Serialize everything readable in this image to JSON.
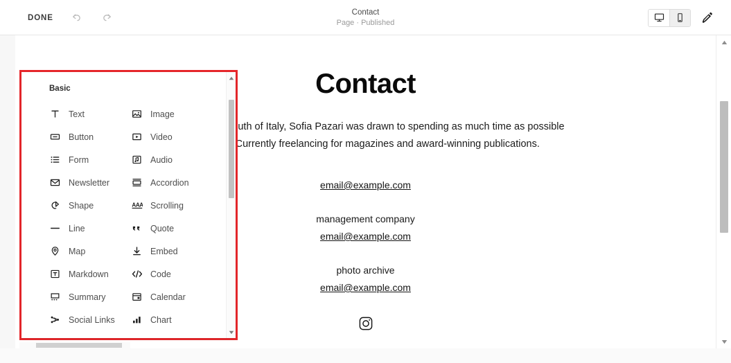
{
  "topbar": {
    "done_label": "DONE",
    "undo_icon": "undo-arrow-icon",
    "redo_icon": "redo-arrow-icon",
    "page_title": "Contact",
    "page_status": "Page · Published",
    "desktop_icon": "desktop-monitor-icon",
    "mobile_icon": "mobile-phone-icon",
    "brush_icon": "paintbrush-icon",
    "desktop_active": true,
    "mobile_active": false
  },
  "panel": {
    "section_label": "Basic",
    "highlight_color": "#e8272b",
    "blocks": [
      {
        "label": "Text",
        "icon": "text-icon"
      },
      {
        "label": "Image",
        "icon": "image-icon"
      },
      {
        "label": "Button",
        "icon": "button-icon"
      },
      {
        "label": "Video",
        "icon": "video-icon"
      },
      {
        "label": "Form",
        "icon": "form-list-icon"
      },
      {
        "label": "Audio",
        "icon": "audio-note-icon"
      },
      {
        "label": "Newsletter",
        "icon": "envelope-icon"
      },
      {
        "label": "Accordion",
        "icon": "accordion-icon"
      },
      {
        "label": "Shape",
        "icon": "shape-icon"
      },
      {
        "label": "Scrolling",
        "icon": "scrolling-text-icon"
      },
      {
        "label": "Line",
        "icon": "line-icon"
      },
      {
        "label": "Quote",
        "icon": "quote-marks-icon"
      },
      {
        "label": "Map",
        "icon": "map-pin-icon"
      },
      {
        "label": "Embed",
        "icon": "embed-download-icon"
      },
      {
        "label": "Markdown",
        "icon": "markdown-icon"
      },
      {
        "label": "Code",
        "icon": "code-brackets-icon"
      },
      {
        "label": "Summary",
        "icon": "summary-icon"
      },
      {
        "label": "Calendar",
        "icon": "calendar-icon"
      },
      {
        "label": "Social Links",
        "icon": "social-links-icon"
      },
      {
        "label": "Chart",
        "icon": "bar-chart-icon"
      }
    ]
  },
  "content": {
    "heading": "Contact",
    "paragraph": "Raised in the south of Italy, Sofia Pazari was drawn to spending as much time as possible outdoors. Currently freelancing for magazines and award-winning publications.",
    "email_primary": "email@example.com",
    "label_management": "management company",
    "email_management": "email@example.com",
    "label_archive": "photo archive",
    "email_archive": "email@example.com",
    "social_icon": "instagram-icon"
  },
  "scrollbars": {
    "panel_up_icon": "scroll-up-arrow-icon",
    "panel_down_icon": "scroll-down-arrow-icon",
    "main_up_icon": "scroll-up-arrow-icon",
    "main_down_icon": "scroll-down-arrow-icon"
  }
}
